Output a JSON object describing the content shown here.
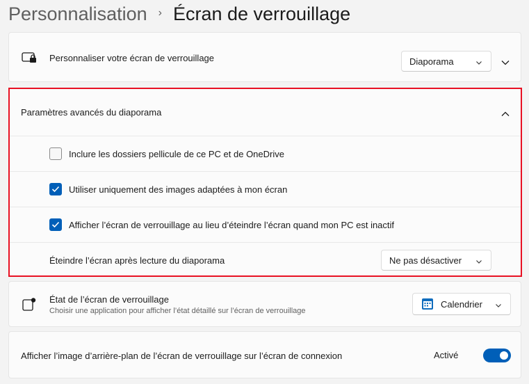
{
  "breadcrumb": {
    "parent": "Personnalisation",
    "separator": "›",
    "current": "Écran de verrouillage"
  },
  "personalize": {
    "label": "Personnaliser votre écran de verrouillage",
    "dropdown_value": "Diaporama",
    "icon": "lock-screen-icon"
  },
  "slideshow_advanced": {
    "title": "Paramètres avancés du diaporama",
    "options": [
      {
        "label": "Inclure les dossiers pellicule de ce PC et de OneDrive",
        "checked": false
      },
      {
        "label": "Utiliser uniquement des images adaptées à mon écran",
        "checked": true
      },
      {
        "label": "Afficher l’écran de verrouillage au lieu d’éteindre l’écran quand mon PC est inactif",
        "checked": true
      }
    ],
    "turn_off": {
      "label": "Éteindre l’écran après lecture du diaporama",
      "dropdown_value": "Ne pas désactiver"
    }
  },
  "lock_status": {
    "label": "État de l’écran de verrouillage",
    "description": "Choisir une application pour afficher l’état détaillé sur l’écran de verrouillage",
    "dropdown_value": "Calendrier",
    "icon": "calendar-icon"
  },
  "background_signin": {
    "label": "Afficher l’image d’arrière-plan de l’écran de verrouillage sur l’écran de connexion",
    "state_label": "Activé",
    "toggle_on": true
  },
  "colors": {
    "accent": "#005fb8",
    "highlight_border": "#e81123"
  }
}
